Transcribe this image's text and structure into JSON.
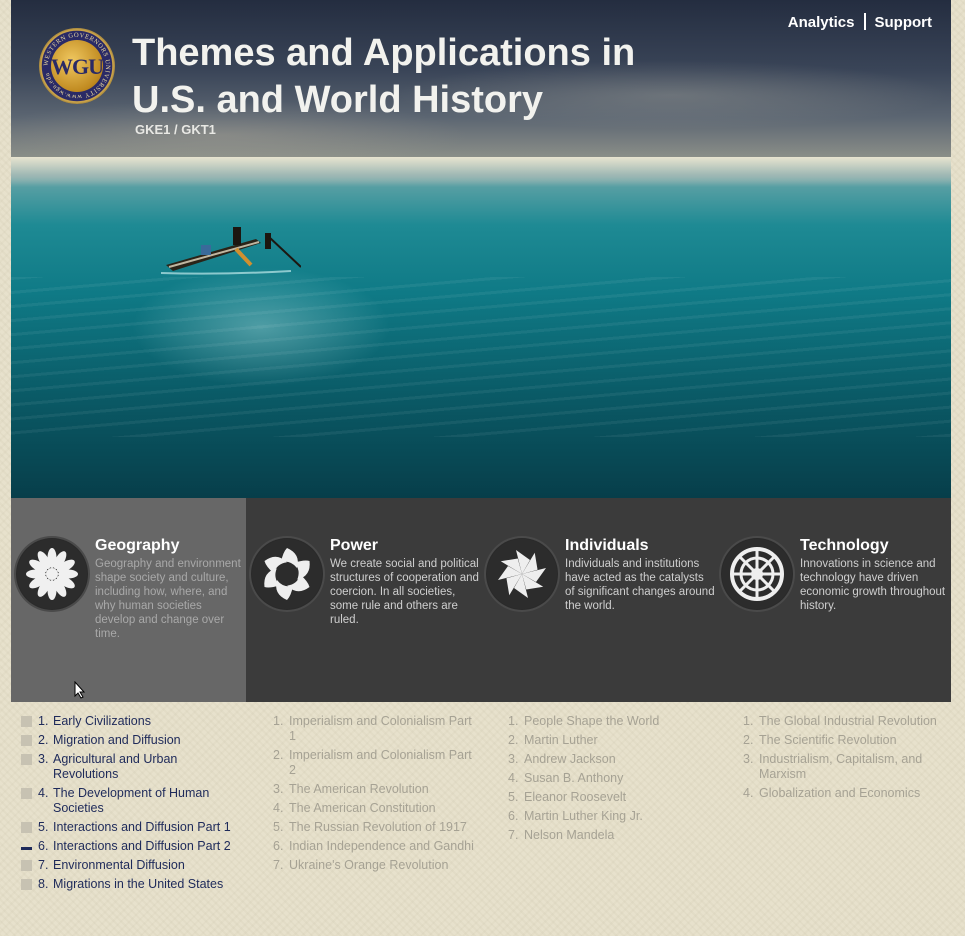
{
  "header": {
    "title": "Themes and Applications in U.S. and World History",
    "course_code": "GKE1 / GKT1",
    "logo_text": "WGU",
    "logo_ring_text": "WESTERN GOVERNORS UNIVERSITY www.wgu.edu",
    "links": [
      "Analytics",
      "Support"
    ]
  },
  "themes": [
    {
      "name": "Geography",
      "description": "Geography and environment shape society and culture, including how, where, and why human societies develop and change over time.",
      "icon": "flower-icon",
      "active": true,
      "items": [
        "Early Civilizations",
        "Migration and Diffusion",
        "Agricultural and Urban Revolutions",
        "The Development of Human Societies",
        "Interactions and Diffusion Part 1",
        "Interactions and Diffusion Part 2",
        "Environmental Diffusion",
        "Migrations in the United States"
      ]
    },
    {
      "name": "Power",
      "description": "We create social and political structures of cooperation and coercion. In all societies, some rule and others are ruled.",
      "icon": "swirl-icon",
      "active": false,
      "items": [
        "Imperialism and Colonialism Part 1",
        "Imperialism and Colonialism Part 2",
        "The American Revolution",
        "The American Constitution",
        "The Russian Revolution of 1917",
        "Indian Independence and Gandhi",
        "Ukraine's Orange Revolution"
      ]
    },
    {
      "name": "Individuals",
      "description": "Individuals and institutions have acted as the catalysts of significant changes around the world.",
      "icon": "pinwheel-icon",
      "active": false,
      "items": [
        "People Shape the World",
        "Martin Luther",
        "Andrew Jackson",
        "Susan B. Anthony",
        "Eleanor Roosevelt",
        "Martin Luther King Jr.",
        "Nelson Mandela"
      ]
    },
    {
      "name": "Technology",
      "description": "Innovations in science and technology have driven economic growth throughout history.",
      "icon": "wheel-icon",
      "active": false,
      "items": [
        "The Global Industrial Revolution",
        "The Scientific Revolution",
        "Industrialism, Capitalism, and Marxism",
        "Globalization and Economics"
      ]
    }
  ],
  "geo_current_item": 6
}
